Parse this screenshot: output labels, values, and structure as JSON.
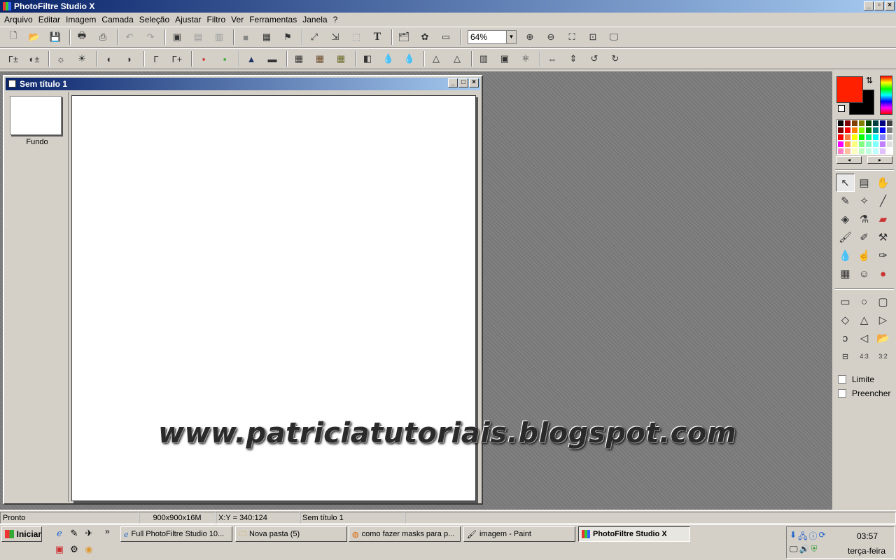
{
  "app": {
    "title": "PhotoFiltre Studio X"
  },
  "menu": [
    "Arquivo",
    "Editar",
    "Imagem",
    "Camada",
    "Seleção",
    "Ajustar",
    "Filtro",
    "Ver",
    "Ferramentas",
    "Janela",
    "?"
  ],
  "toolbar": {
    "zoom": "64%"
  },
  "document": {
    "title": "Sem título 1",
    "layer_label": "Fundo"
  },
  "watermark": "www.patriciatutoriais.blogspot.com",
  "colors": {
    "foreground": "#ff2000",
    "background": "#000000"
  },
  "options": {
    "limit_label": "Limite",
    "fill_label": "Preencher"
  },
  "status": {
    "state": "Pronto",
    "size": "900x900x16M",
    "coords": "X:Y = 340:124",
    "doc": "Sem título 1"
  },
  "taskbar": {
    "start_label": "Iniciar",
    "items": [
      {
        "label": "Full PhotoFiltre Studio 10..."
      },
      {
        "label": "Nova pasta (5)"
      },
      {
        "label": "como fazer masks para p..."
      },
      {
        "label": "imagem - Paint"
      },
      {
        "label": "PhotoFiltre Studio X"
      }
    ],
    "clock": "03:57",
    "day": "terça-feira"
  }
}
